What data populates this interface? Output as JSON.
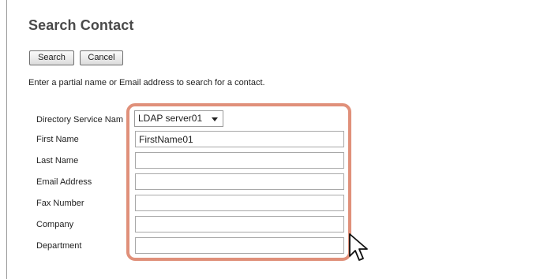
{
  "page": {
    "title": "Search Contact"
  },
  "toolbar": {
    "search_label": "Search",
    "cancel_label": "Cancel"
  },
  "instructions": "Enter a partial name or Email address to search for a contact.",
  "form": {
    "directory_service": {
      "label": "Directory Service Nam",
      "value": "LDAP server01"
    },
    "first_name": {
      "label": "First Name",
      "value": "FirstName01"
    },
    "last_name": {
      "label": "Last Name",
      "value": ""
    },
    "email_address": {
      "label": "Email Address",
      "value": ""
    },
    "fax_number": {
      "label": "Fax Number",
      "value": ""
    },
    "company": {
      "label": "Company",
      "value": ""
    },
    "department": {
      "label": "Department",
      "value": ""
    }
  },
  "colors": {
    "highlight": "#e0907a",
    "title": "#4a4a4a"
  },
  "icons": {
    "cursor": "mouse-pointer-icon",
    "dropdown": "chevron-down-icon"
  }
}
